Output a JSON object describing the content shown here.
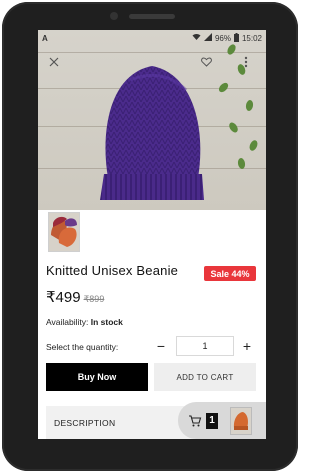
{
  "status_bar": {
    "carrier_icon": "A",
    "battery": "96%",
    "time": "15:02"
  },
  "hero": {
    "left_action_icon": "close-icon",
    "right_icons": [
      "heart-icon",
      "more-vertical-icon"
    ]
  },
  "product": {
    "title": "Knitted Unisex Beanie",
    "sale_badge": "Sale 44%",
    "price_current": "₹499",
    "price_old": "₹899",
    "availability_label": "Availability:",
    "availability_value": "In stock",
    "quantity_label": "Select the quantity:",
    "quantity_value": "1",
    "quantity_minus": "−",
    "quantity_plus": "+"
  },
  "actions": {
    "buy_now": "Buy Now",
    "add_to_cart": "ADD TO CART"
  },
  "sections": {
    "description": "DESCRIPTION"
  },
  "cart": {
    "count": "1"
  },
  "colors": {
    "hat": "#4a2a8a",
    "sale": "#e9363b",
    "primary_button": "#000000"
  }
}
